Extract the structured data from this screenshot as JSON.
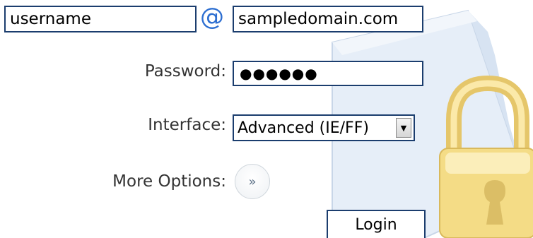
{
  "login": {
    "username_value": "username",
    "at_symbol": "@",
    "domain_value": "sampledomain.com",
    "password_label": "Password:",
    "password_mask": "●●●●●●",
    "interface_label": "Interface:",
    "interface_selected": "Advanced (IE/FF)",
    "more_options_label": "More Options:",
    "more_options_glyph": "»",
    "login_button": "Login"
  },
  "icons": {
    "background": "document-icon",
    "lock": "padlock-icon",
    "dropdown": "arrow-down-icon",
    "more": "double-chevron-right-icon"
  },
  "colors": {
    "field_border": "#1b3d6e",
    "at_sign": "#2e6fd1",
    "label_text": "#333333",
    "lock_gold": "#f0d47a"
  }
}
